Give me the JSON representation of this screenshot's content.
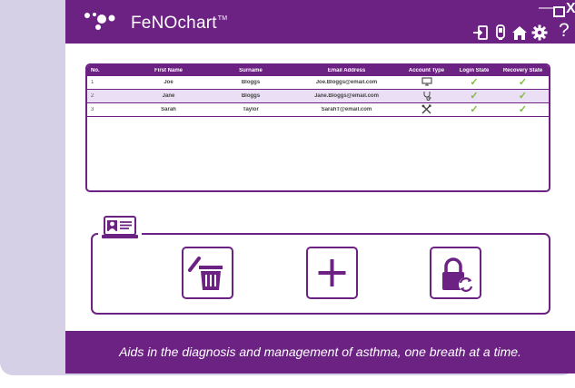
{
  "app": {
    "title": "FeNOchart",
    "trademark": "TM"
  },
  "window_controls": {
    "minimize": "—",
    "close": "X"
  },
  "toolbar": {
    "icons": [
      "logout-icon",
      "device-icon",
      "home-icon",
      "settings-icon",
      "help-icon"
    ],
    "help_glyph": "?"
  },
  "table": {
    "headers": [
      "No.",
      "First Name",
      "Surname",
      "Email Address",
      "Account Type",
      "Login State",
      "Recovery State"
    ],
    "rows": [
      {
        "no": "1",
        "first_name": "Joe",
        "surname": "Bloggs",
        "email": "Joe.Bloggs@email.com",
        "account_type_icon": "monitor-icon",
        "login_state": "✓",
        "recovery_state": "✓",
        "selected": false
      },
      {
        "no": "2",
        "first_name": "Jane",
        "surname": "Bloggs",
        "email": "Jane.Bloggs@email.com",
        "account_type_icon": "stethoscope-icon",
        "login_state": "✓",
        "recovery_state": "✓",
        "selected": true
      },
      {
        "no": "3",
        "first_name": "Sarah",
        "surname": "Taylor",
        "email": "SarahT@email.com",
        "account_type_icon": "tools-icon",
        "login_state": "✓",
        "recovery_state": "✓",
        "selected": false
      }
    ]
  },
  "actions": {
    "section_icon": "user-card-icon",
    "buttons": [
      "delete-user-icon",
      "add-user-icon",
      "reset-lock-icon"
    ]
  },
  "footer": {
    "tagline": "Aids in the diagnosis and management of asthma, one breath at a time."
  },
  "colors": {
    "brand_purple": "#6c2283",
    "check_green": "#7cbf3a",
    "selected_row": "#eadff4",
    "outer_background": "#d6d0e6"
  }
}
